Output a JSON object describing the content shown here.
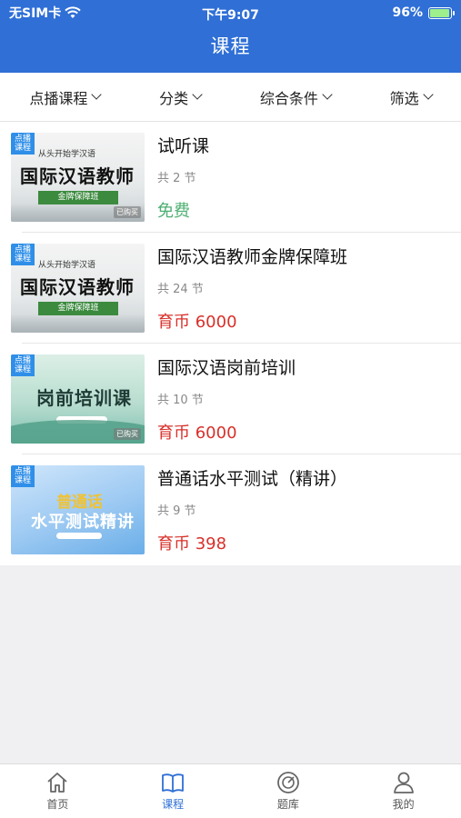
{
  "status": {
    "carrier": "无SIM卡",
    "time": "下午9:07",
    "battery": "96%"
  },
  "header": {
    "title": "课程"
  },
  "filters": [
    "点播课程",
    "分类",
    "综合条件",
    "筛选"
  ],
  "courses": [
    {
      "thumb_tag": "点播课程",
      "thumb_sub": "从头开始学汉语",
      "thumb_title": "国际汉语教师",
      "thumb_band": "金牌保障班",
      "thumb_badge": "已购买",
      "name": "试听课",
      "count": "共 2 节",
      "price": "免费"
    },
    {
      "thumb_tag": "点播课程",
      "thumb_sub": "从头开始学汉语",
      "thumb_title": "国际汉语教师",
      "thumb_band": "金牌保障班",
      "name": "国际汉语教师金牌保障班",
      "count": "共 24 节",
      "price": "育币 6000"
    },
    {
      "thumb_tag": "点播课程",
      "thumb_title": "岗前培训课",
      "thumb_badge": "已购买",
      "name": "国际汉语岗前培训",
      "count": "共 10 节",
      "price": "育币 6000"
    },
    {
      "thumb_tag": "点播课程",
      "thumb_title_1": "普通话",
      "thumb_title_2": "水平测试精讲",
      "name": "普通话水平测试（精讲）",
      "count": "共 9 节",
      "price": "育币 398"
    }
  ],
  "tabbar": [
    {
      "label": "首页",
      "icon": "home-icon"
    },
    {
      "label": "课程",
      "icon": "book-icon"
    },
    {
      "label": "题库",
      "icon": "target-icon"
    },
    {
      "label": "我的",
      "icon": "user-icon"
    }
  ],
  "colors": {
    "primary": "#2f6fd6",
    "free": "#4caf72",
    "price": "#d8302a"
  }
}
